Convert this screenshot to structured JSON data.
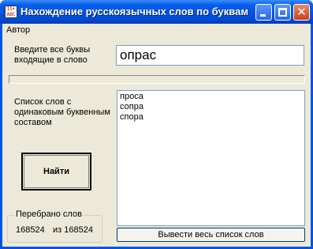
{
  "window": {
    "title": "Нахождение русскоязычных слов по буквам",
    "icon": "app-icon",
    "close_glyph": "✕"
  },
  "menu": {
    "items": [
      {
        "label": "Автор"
      }
    ]
  },
  "input": {
    "label": "Введите все буквы входящие в слово",
    "value": "опрас"
  },
  "progress": {
    "fraction": 0
  },
  "results": {
    "label": "Список слов с одинаковым буквенным составом",
    "items": [
      "проса",
      "сопра",
      "спора"
    ]
  },
  "find_button": {
    "label": "Найти"
  },
  "counter": {
    "title": "Перебрано слов",
    "checked": "168524",
    "total": "из 168524"
  },
  "output_button": {
    "label": "Вывести весь список слов"
  }
}
